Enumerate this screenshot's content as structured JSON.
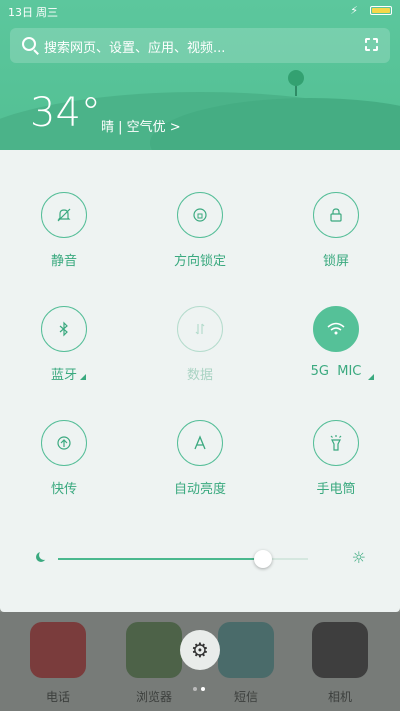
{
  "status": {
    "date": "13日",
    "weekday": "周三",
    "charging_icon": "bolt-icon",
    "battery_icon": "battery-icon"
  },
  "search": {
    "placeholder": "搜索网页、设置、应用、视频..."
  },
  "weather": {
    "temperature": "34°",
    "description": "晴 | 空气优 >"
  },
  "toggles": [
    {
      "label": "静音",
      "icon": "bell-off-icon",
      "state": "off"
    },
    {
      "label": "方向锁定",
      "icon": "rotation-lock-icon",
      "state": "off"
    },
    {
      "label": "锁屏",
      "icon": "lock-icon",
      "state": "off"
    },
    {
      "label": "蓝牙",
      "icon": "bluetooth-icon",
      "state": "off"
    },
    {
      "label": "数据",
      "icon": "data-icon",
      "state": "disabled"
    },
    {
      "label": "5G  MIC",
      "icon": "wifi-icon",
      "state": "on"
    },
    {
      "label": "快传",
      "icon": "share-icon",
      "state": "off"
    },
    {
      "label": "自动亮度",
      "icon": "auto-brightness-icon",
      "state": "off"
    },
    {
      "label": "手电筒",
      "icon": "flashlight-icon",
      "state": "off"
    }
  ],
  "brightness": {
    "level": 0.82
  },
  "dock": {
    "apps": [
      {
        "label": "电话",
        "color": "#7a3c3c"
      },
      {
        "label": "浏览器",
        "color": "#4d6248"
      },
      {
        "label": "短信",
        "color": "#4a6b6a"
      },
      {
        "label": "相机",
        "color": "#3e3e3e"
      }
    ]
  },
  "colors": {
    "accent": "#55be98",
    "header": "#5cc79d",
    "panel": "#eef3f2"
  }
}
